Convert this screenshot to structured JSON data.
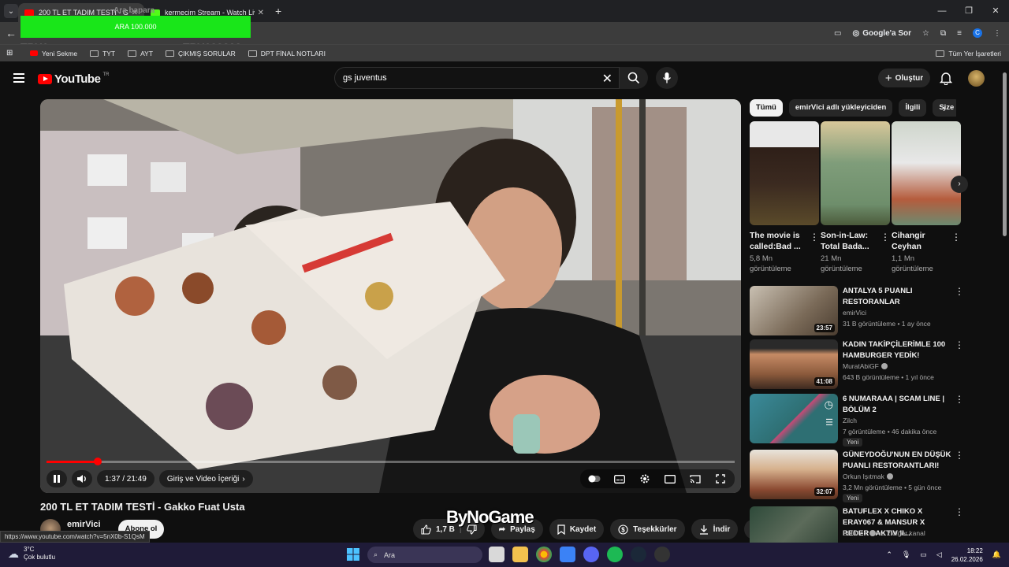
{
  "browser": {
    "tabs": [
      {
        "title": "200 TL ET TADIM TESTİ - Gakko Fuat Usta",
        "active": true,
        "favicon_color": "#ff0000"
      },
      {
        "title": "kermecim Stream - Watch Live",
        "active": false,
        "favicon_color": "#53fc18"
      }
    ],
    "overlay": {
      "bar_text": "ARA 100.000",
      "label_left": "TRY1",
      "label_right": "TRY100000",
      "tab_overlay": "Ara bapara"
    },
    "toolbar": {
      "google_sor": "Google'a Sor",
      "profile_initial": "C"
    },
    "bookmarks": [
      "Yeni Sekme",
      "TYT",
      "AYT",
      "ÇIKMIŞ SORULAR",
      "DPT FİNAL NOTLARI"
    ],
    "all_bookmarks": "Tüm Yer İşaretleri",
    "status_url": "https://www.youtube.com/watch?v=5nX0b-S1QsM"
  },
  "youtube": {
    "logo_text": "YouTube",
    "country_code": "TR",
    "search": {
      "value": "gs juventus"
    },
    "create_label": "Oluştur",
    "player": {
      "time_label": "1:37 / 21:49",
      "chapter_label": "Giriş ve Video İçeriği",
      "progress": 0.074
    },
    "video": {
      "title": "200 TL ET TADIM TESTİ - Gakko Fuat Usta",
      "channel": "emirVici",
      "subscribe": "Abone ol",
      "likes": "1,7 B",
      "share": "Paylaş",
      "save": "Kaydet",
      "thanks": "Teşekkürler",
      "download": "İndir"
    },
    "watermark": "ByNoGame",
    "chips": [
      "Tümü",
      "emirVici adlı yükleyiciden",
      "İlgili",
      "Size"
    ],
    "shorts": [
      {
        "title": "The movie is called:Bad ...",
        "views": "5,8 Mn görüntüleme"
      },
      {
        "title": "Son-in-Law: Total Bada...",
        "views": "21 Mn görüntüleme"
      },
      {
        "title": "Cihangir Ceyhan",
        "views": "1,1 Mn görüntüleme"
      }
    ],
    "recommended": [
      {
        "title": "ANTALYA 5 PUANLI RESTORANLAR",
        "channel": "emirVici",
        "meta": "31 B görüntüleme • 1 ay önce",
        "duration": "23:57",
        "new": ""
      },
      {
        "title": "KADIN TAKİPÇİLERİMLE 100 HAMBURGER YEDİK!",
        "channel": "MuratAbiGF",
        "meta": "643 B görüntüleme • 1 yıl önce",
        "duration": "41:08",
        "new": ""
      },
      {
        "title": "6 NUMARAAA | SCAM LINE | BÖLÜM 2",
        "channel": "Zilch",
        "meta": "7 görüntüleme • 46 dakika önce",
        "duration": "",
        "new": "Yeni"
      },
      {
        "title": "GÜNEYDOĞU'NUN EN DÜŞÜK PUANLI RESTORANTLARI!",
        "channel": "Orkun Işıtmak",
        "meta": "3,2 Mn görüntüleme • 5 gün önce",
        "duration": "32:07",
        "new": "Yeni"
      },
      {
        "title": "BATUFLEX X CHIKO X ERAY067 & MANSUR X REDER - AKTIV II...",
        "channel": "Batuflex",
        "channel_extra": "ve 2 diğer kanal",
        "meta": "",
        "duration": "",
        "new": ""
      }
    ]
  },
  "taskbar": {
    "temp": "3°C",
    "weather": "Çok bulutlu",
    "search": "Ara",
    "time": "18:22",
    "date": "26.02.2026"
  }
}
